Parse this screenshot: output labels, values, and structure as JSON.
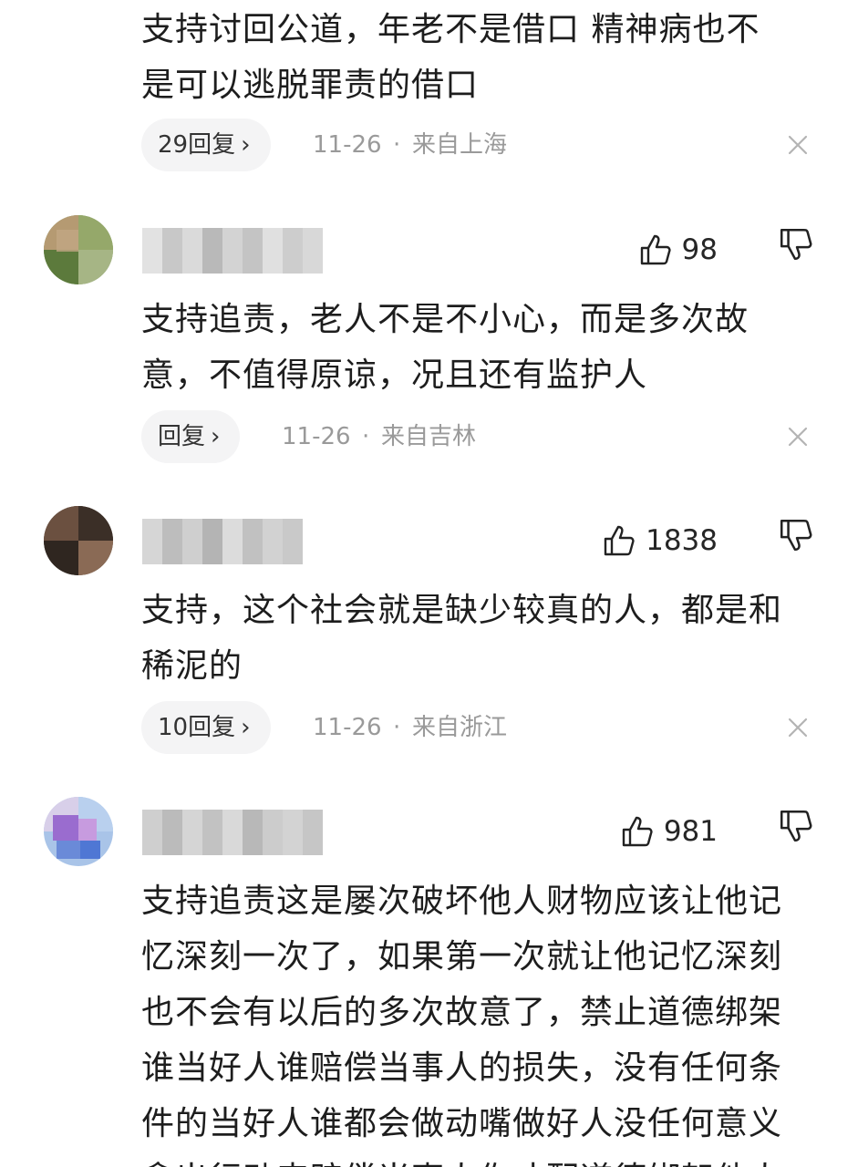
{
  "comments": [
    {
      "text_lines": [
        "支持讨回公道，年老不是借口 精神病也不",
        "是可以逃脱罪责的借口"
      ],
      "reply_label": "29回复",
      "date": "11-26",
      "location": "来自上海"
    },
    {
      "likes": "98",
      "text_lines": [
        "支持追责，老人不是不小心，而是多次故",
        "意，不值得原谅，况且还有监护人"
      ],
      "reply_label": "回复",
      "date": "11-26",
      "location": "来自吉林"
    },
    {
      "likes": "1838",
      "text_lines": [
        "支持，这个社会就是缺少较真的人，都是和",
        "稀泥的"
      ],
      "reply_label": "10回复",
      "date": "11-26",
      "location": "来自浙江"
    },
    {
      "likes": "981",
      "text_lines": [
        "支持追责这是屡次破坏他人财物应该让他记",
        "忆深刻一次了，如果第一次就让他记忆深刻",
        "也不会有以后的多次故意了，禁止道德绑架",
        "谁当好人谁赔偿当事人的损失，没有任何条",
        "件的当好人谁都会做动嘴做好人没任何意义",
        "拿出行动来赔偿当事人你才配道德绑架他人"
      ]
    }
  ],
  "separator": "·",
  "chevron": "›",
  "icons": {
    "like": "thumbs-up-icon",
    "dislike": "thumbs-down-icon",
    "close": "close-icon",
    "chevron": "chevron-right-icon"
  },
  "colors": {
    "pill_bg": "#f4f4f5",
    "meta_text": "#9a9a9a",
    "body_text": "#1d1d1d"
  }
}
